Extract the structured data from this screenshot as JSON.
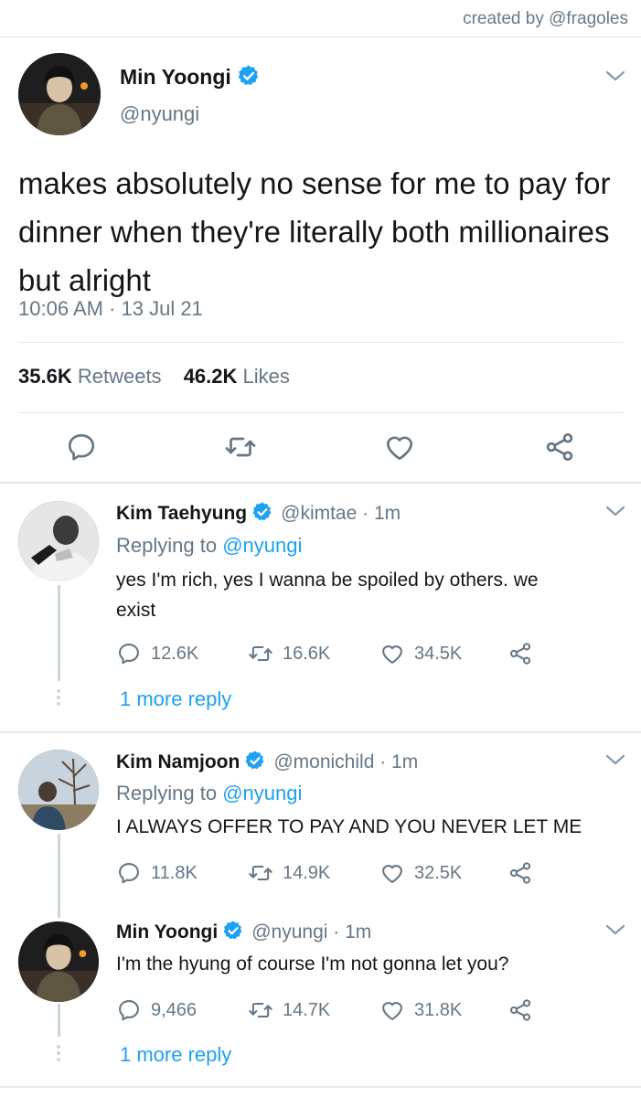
{
  "credit": "created by @fragoles",
  "main_tweet": {
    "name": "Min Yoongi",
    "handle": "@nyungi",
    "text": "makes absolutely no sense for me to pay for dinner when they're literally both millionaires but alright",
    "timestamp": "10:06 AM · 13 Jul 21",
    "retweets_count": "35.6K",
    "retweets_label": "Retweets",
    "likes_count": "46.2K",
    "likes_label": "Likes"
  },
  "replies": [
    {
      "name": "Kim Taehyung",
      "handle": "@kimtae · 1m",
      "replying_prefix": "Replying to",
      "replying_to": "@nyungi",
      "text": "yes I'm rich, yes I wanna be spoiled by others. we exist",
      "replies": "12.6K",
      "retweets": "16.6K",
      "likes": "34.5K",
      "more_reply": "1 more reply"
    },
    {
      "name": "Kim Namjoon",
      "handle": "@monichild · 1m",
      "replying_prefix": "Replying to",
      "replying_to": "@nyungi",
      "text": "I ALWAYS OFFER TO PAY AND YOU NEVER LET ME",
      "replies": "11.8K",
      "retweets": "14.9K",
      "likes": "32.5K"
    },
    {
      "name": "Min Yoongi",
      "handle": "@nyungi · 1m",
      "text": "I'm the hyung of course I'm not gonna let you?",
      "replies": "9,466",
      "retweets": "14.7K",
      "likes": "31.8K",
      "more_reply": "1 more reply"
    }
  ],
  "colors": {
    "link": "#1da1f2",
    "muted": "#657786",
    "text": "#14171a",
    "divider": "#e1e8ed"
  },
  "icons": [
    "verified-badge-icon",
    "chevron-down-icon",
    "reply-icon",
    "retweet-icon",
    "like-icon",
    "share-icon"
  ]
}
